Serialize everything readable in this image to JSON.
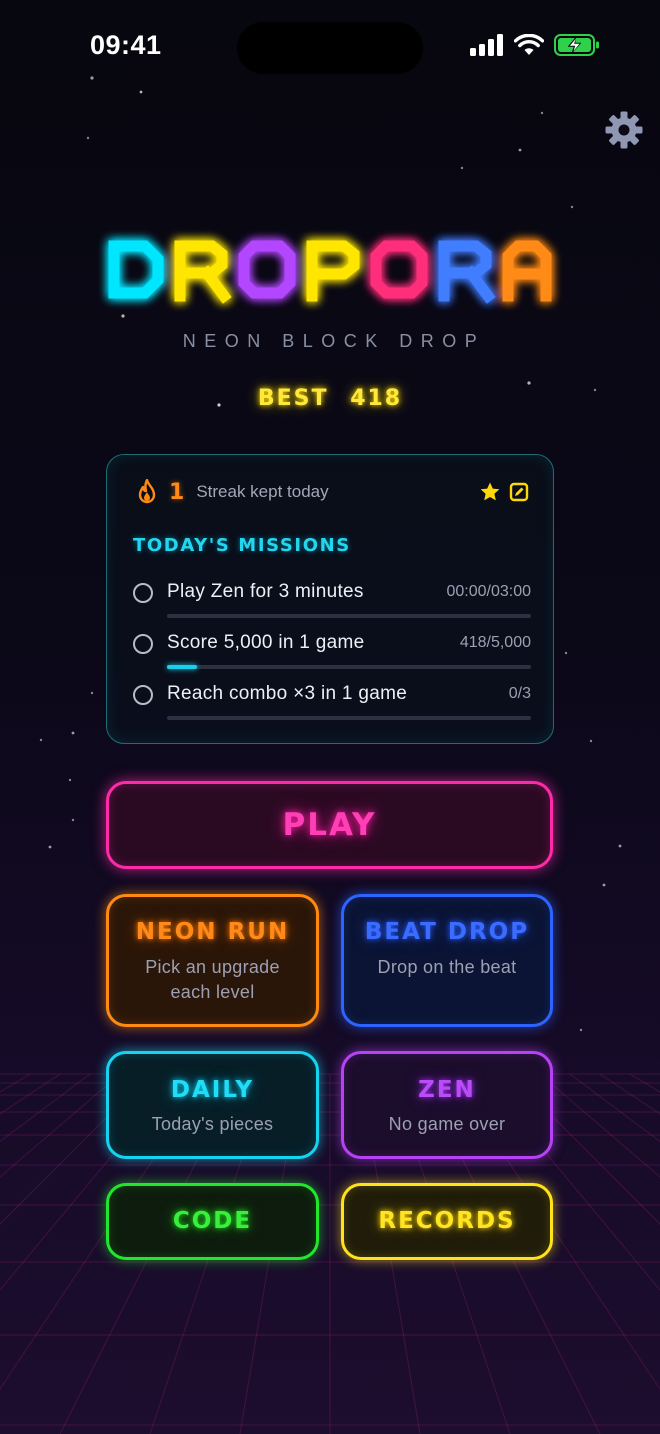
{
  "status_bar": {
    "time": "09:41"
  },
  "logo": {
    "letters": [
      {
        "char": "D",
        "color": "#00e6ff"
      },
      {
        "char": "R",
        "color": "#ffe600"
      },
      {
        "char": "O",
        "color": "#b347ff"
      },
      {
        "char": "P",
        "color": "#ffe600"
      },
      {
        "char": "O",
        "color": "#ff2f7a"
      },
      {
        "char": "R",
        "color": "#3f7dff"
      },
      {
        "char": "A",
        "color": "#ff8a12"
      }
    ]
  },
  "tagline": "NEON BLOCK DROP",
  "best": {
    "label": "BEST",
    "value": "418"
  },
  "streak": {
    "count": "1",
    "text": "Streak kept today"
  },
  "missions": {
    "title": "TODAY'S MISSIONS",
    "items": [
      {
        "label": "Play Zen for 3 minutes",
        "value": "00:00/03:00",
        "progress": 0.0
      },
      {
        "label": "Score 5,000 in 1 game",
        "value": "418/5,000",
        "progress": 0.0836
      },
      {
        "label": "Reach combo ×3 in 1 game",
        "value": "0/3",
        "progress": 0.0
      }
    ]
  },
  "buttons": {
    "play": "PLAY",
    "neon_run": {
      "title": "NEON RUN",
      "subtitle_line1": "Pick an upgrade",
      "subtitle_line2": "each level"
    },
    "beat_drop": {
      "title": "BEAT DROP",
      "subtitle": "Drop on the beat"
    },
    "daily": {
      "title": "DAILY",
      "subtitle": "Today's pieces"
    },
    "zen": {
      "title": "ZEN",
      "subtitle": "No game over"
    },
    "code": "CODE",
    "records": "RECORDS"
  },
  "icons": [
    "signal-icon",
    "wifi-icon",
    "battery-charging-icon",
    "gear-icon",
    "flame-icon",
    "star-icon",
    "edit-icon"
  ],
  "colors": {
    "play": "#ff2aa8",
    "neon_run": "#ff8a12",
    "beat_drop": "#2d63ff",
    "daily": "#16d4ef",
    "zen": "#b742f5",
    "code": "#22e62c",
    "records": "#ffe21a"
  }
}
